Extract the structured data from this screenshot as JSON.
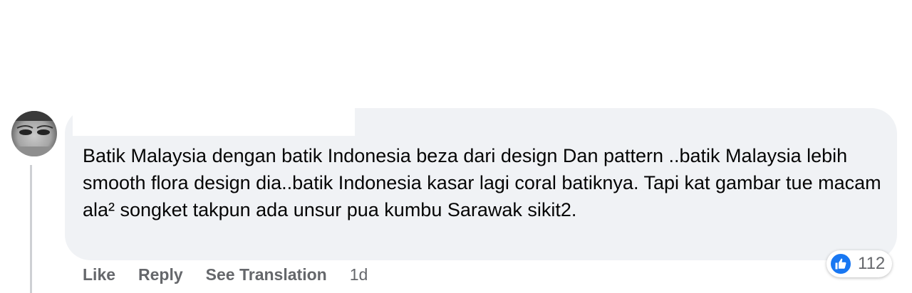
{
  "comment": {
    "text": "Batik Malaysia dengan batik Indonesia beza dari design Dan pattern ..batik Malaysia lebih smooth flora design dia..batik Indonesia kasar lagi coral batiknya. Tapi kat gambar tue macam ala² songket takpun ada unsur pua kumbu Sarawak sikit2.",
    "reaction_icon": "like-icon",
    "reaction_count": "112"
  },
  "actions": {
    "like_label": "Like",
    "reply_label": "Reply",
    "translate_label": "See Translation",
    "timestamp": "1d"
  },
  "colors": {
    "bubble": "#f0f2f5",
    "like_blue": "#1877f2",
    "secondary_text": "#65676b"
  }
}
